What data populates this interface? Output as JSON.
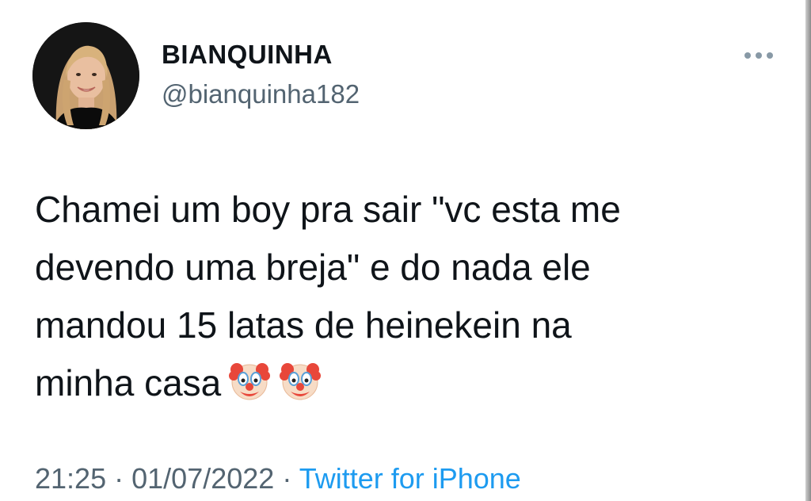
{
  "tweet": {
    "author": {
      "display_name": "BIANQUINHA",
      "handle": "@bianquinha182",
      "avatar_icon": "profile-photo"
    },
    "more_icon": "ellipsis-horizontal-icon",
    "text_lines": [
      "Chamei um boy pra sair \"vc esta me",
      "devendo uma breja\" e do nada ele",
      "mandou 15 latas de heinekein na",
      "minha casa"
    ],
    "emojis": [
      "clown-face",
      "clown-face"
    ],
    "time": "21:25",
    "separator": "·",
    "date": "01/07/2022",
    "source": "Twitter for iPhone"
  },
  "colors": {
    "text_primary": "#0f1419",
    "text_secondary": "#536471",
    "link": "#1d9bf0",
    "background": "#ffffff"
  }
}
